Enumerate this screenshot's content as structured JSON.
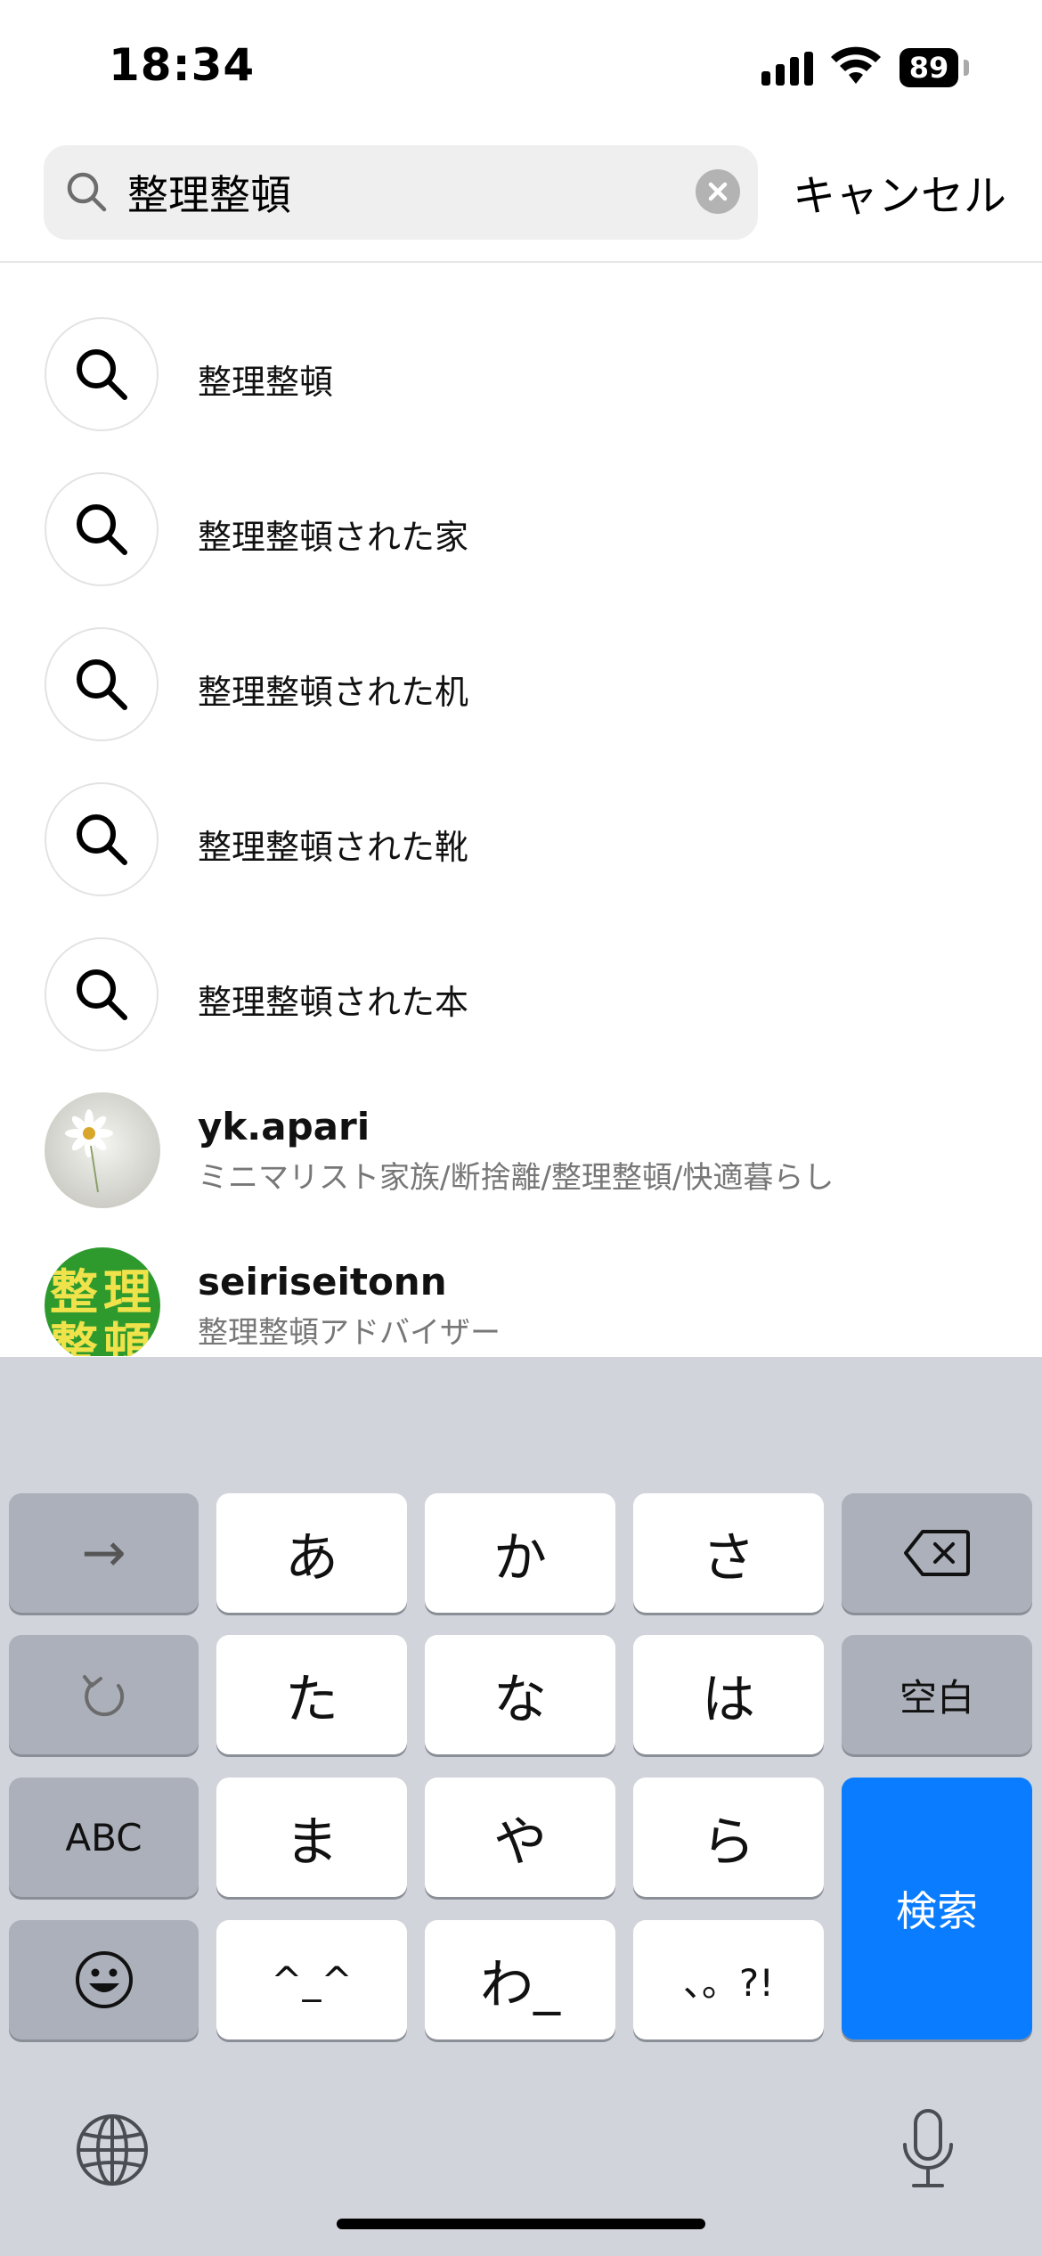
{
  "status": {
    "time": "18:34",
    "battery": "89"
  },
  "search": {
    "query": "整理整頓",
    "cancel_label": "キャンセル"
  },
  "suggestions": [
    {
      "label": "整理整頓"
    },
    {
      "label": "整理整頓された家"
    },
    {
      "label": "整理整頓された机"
    },
    {
      "label": "整理整頓された靴"
    },
    {
      "label": "整理整頓された本"
    }
  ],
  "accounts": [
    {
      "username": "yk.apari",
      "bio": "ミニマリスト家族/断捨離/整理整頓/快適暮らし"
    },
    {
      "username": "seiriseitonn",
      "bio": "整理整頓アドバイザー",
      "avatar_text": [
        "整",
        "理",
        "整",
        "頓"
      ]
    }
  ],
  "keyboard": {
    "row1": [
      "→",
      "あ",
      "か",
      "さ"
    ],
    "row2": [
      "た",
      "な",
      "は",
      "空白"
    ],
    "row3": [
      "ABC",
      "ま",
      "や",
      "ら"
    ],
    "row4": [
      "^_^",
      "わ_",
      "、。?!"
    ],
    "search_key": "検索"
  },
  "colors": {
    "accent": "#0a7cff",
    "keyboard_bg": "#d1d4db",
    "avatar_green": "#2e9a2e",
    "avatar_text": "#f0e24a"
  }
}
